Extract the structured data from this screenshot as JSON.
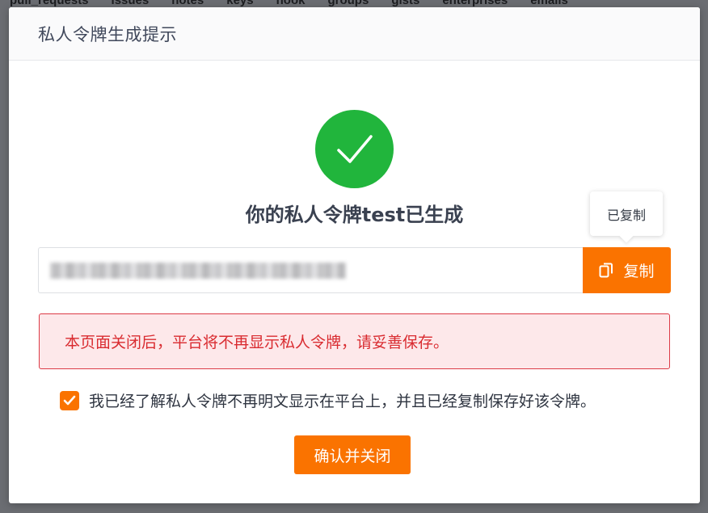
{
  "background_tabs": [
    "pull_requests",
    "issues",
    "notes",
    "keys",
    "hook",
    "groups",
    "gists",
    "enterprises",
    "emails"
  ],
  "dialog": {
    "title": "私人令牌生成提示",
    "success_icon": "check-circle-icon",
    "headline": "你的私人令牌test已生成",
    "token": {
      "value_obscured": true
    },
    "copy_button": {
      "label": "复制",
      "icon": "copy-icon"
    },
    "tooltip": "已复制",
    "warning": "本页面关闭后，平台将不再显示私人令牌，请妥善保存。",
    "acknowledgement": {
      "checked": true,
      "label": "我已经了解私人令牌不再明文显示在平台上，并且已经复制保存好该令牌。"
    },
    "confirm_button": "确认并关闭"
  },
  "colors": {
    "accent": "#fa7300",
    "success": "#21b53c",
    "warning_text": "#d92b30",
    "warning_bg": "#fde8ea",
    "overlay": "#6b6d72"
  }
}
